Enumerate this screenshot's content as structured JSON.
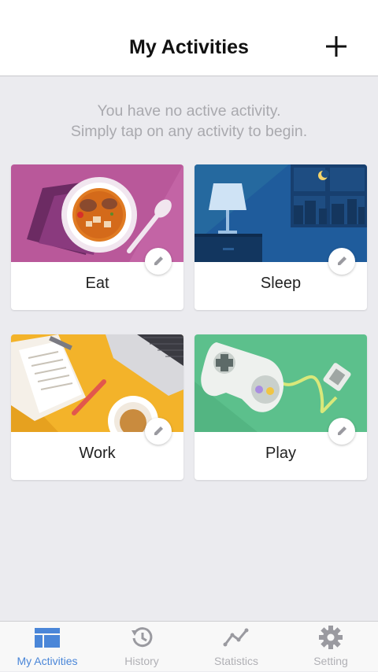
{
  "header": {
    "title": "My Activities"
  },
  "empty_state": {
    "line1": "You have no active activity.",
    "line2": "Simply tap on any activity to begin."
  },
  "activities": [
    {
      "label": "Eat",
      "color": "#b9589a"
    },
    {
      "label": "Sleep",
      "color": "#1f5c9c"
    },
    {
      "label": "Work",
      "color": "#f3b32a"
    },
    {
      "label": "Play",
      "color": "#5cc08c"
    }
  ],
  "tabbar": {
    "active_color": "#4a86d8",
    "inactive_color": "#b0b0b5",
    "tabs": [
      {
        "label": "My Activities",
        "icon": "grid-icon",
        "active": true
      },
      {
        "label": "History",
        "icon": "history-icon",
        "active": false
      },
      {
        "label": "Statistics",
        "icon": "line-chart-icon",
        "active": false
      },
      {
        "label": "Setting",
        "icon": "gear-icon",
        "active": false
      }
    ]
  }
}
